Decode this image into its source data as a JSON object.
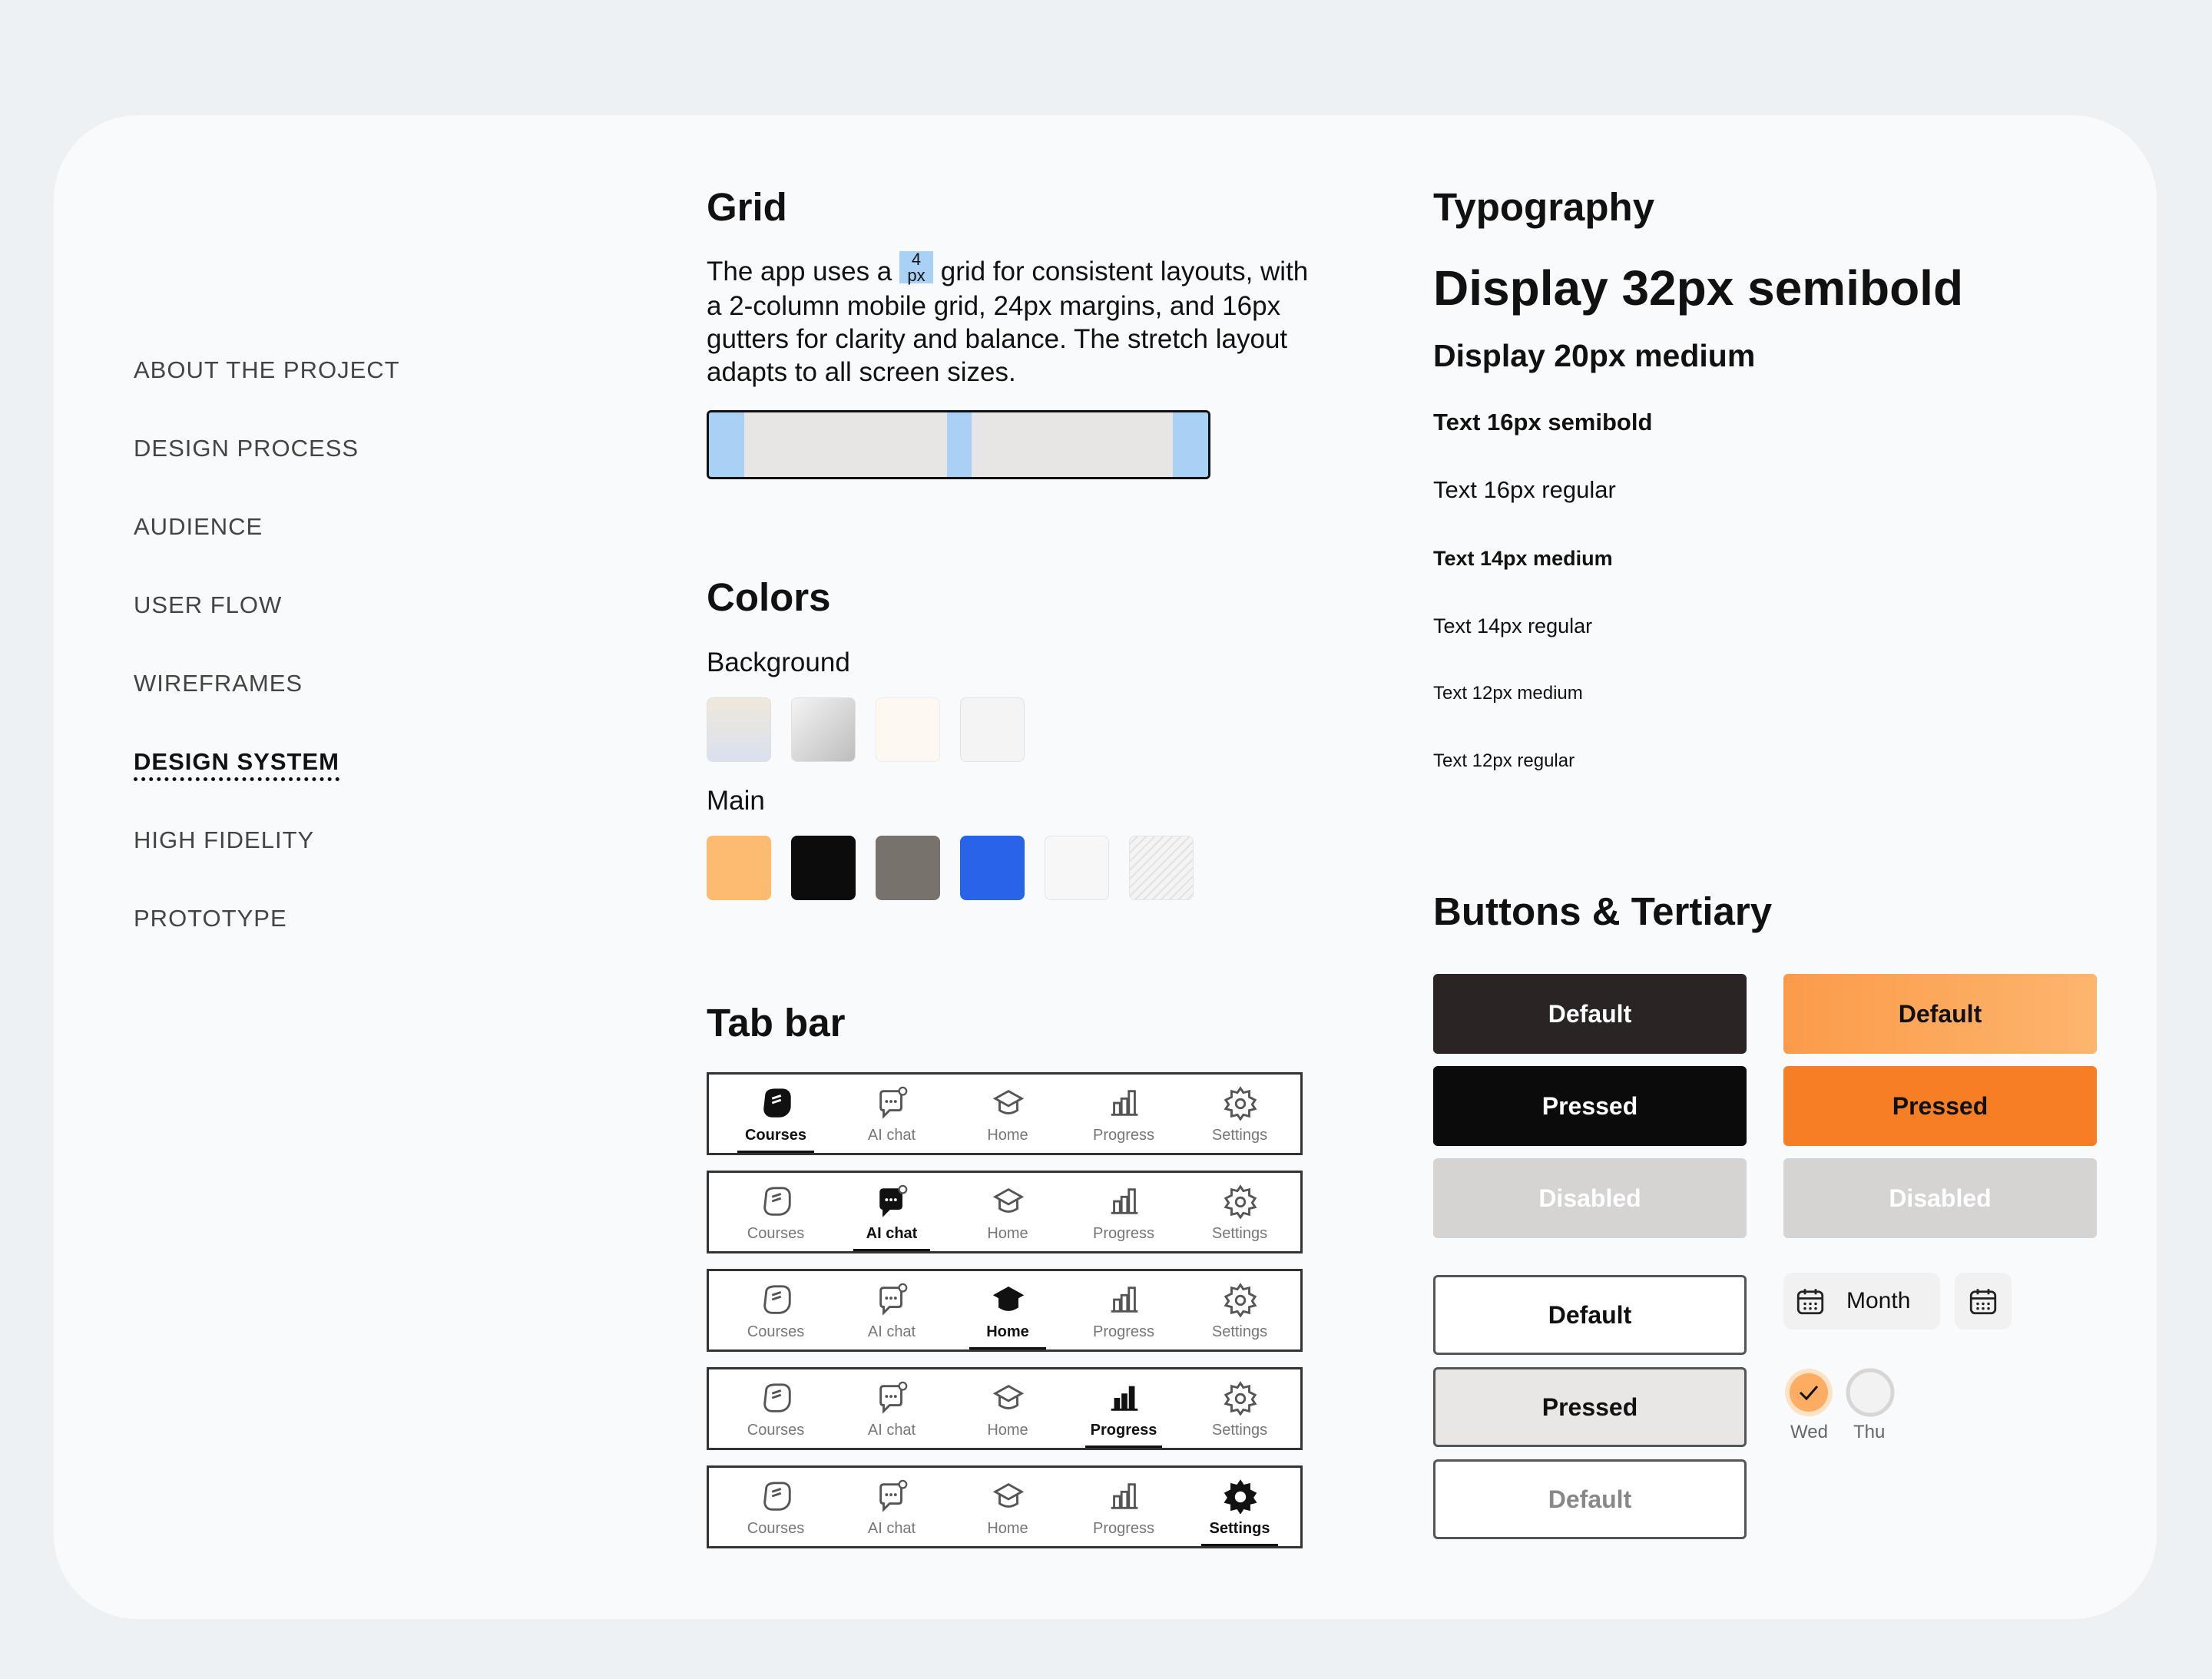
{
  "nav": [
    {
      "label": "ABOUT THE PROJECT"
    },
    {
      "label": "DESIGN PROCESS"
    },
    {
      "label": "AUDIENCE"
    },
    {
      "label": "USER FLOW"
    },
    {
      "label": "WIREFRAMES"
    },
    {
      "label": "DESIGN SYSTEM",
      "active": true
    },
    {
      "label": "HIGH FIDELITY"
    },
    {
      "label": "PROTOTYPE"
    }
  ],
  "grid": {
    "title": "Grid",
    "text_before": "The app uses a ",
    "unit_num": "4",
    "unit_px": "px",
    "text_after": " grid for consistent layouts, with a 2-column mobile grid, 24px margins, and 16px gutters for clarity and balance. The stretch layout adapts to all screen sizes."
  },
  "colors": {
    "title": "Colors",
    "background_label": "Background",
    "main_label": "Main",
    "background": [
      "#e9e6df",
      "#dcdcdc",
      "#fdf8f0",
      "#f4f4f4"
    ],
    "main": [
      "#fdbb72",
      "#0c0c0c",
      "#77726c",
      "#2764e8",
      "#f7f7f7",
      "#ececec"
    ]
  },
  "tabbar": {
    "title": "Tab bar",
    "tabs": [
      "Courses",
      "AI chat",
      "Home",
      "Progress",
      "Settings"
    ]
  },
  "typography": {
    "title": "Typography",
    "samples": [
      "Display 32px semibold",
      "Display 20px medium",
      "Text 16px semibold",
      "Text 16px regular",
      "Text 14px medium",
      "Text 14px regular",
      "Text 12px medium",
      "Text 12px regular"
    ]
  },
  "buttons": {
    "title": "Buttons & Tertiary",
    "dark": [
      "Default",
      "Pressed",
      "Disabled"
    ],
    "orange": [
      "Default",
      "Pressed",
      "Disabled"
    ],
    "outline": [
      "Default",
      "Pressed",
      "Default"
    ],
    "month_label": "Month",
    "days": [
      "Wed",
      "Thu"
    ],
    "colors": {
      "dark_default": "#2a2424",
      "dark_pressed": "#0b0b0b",
      "orange_default": "#fcad61",
      "orange_pressed": "#f67e24",
      "disabled": "#d6d4d3"
    }
  }
}
